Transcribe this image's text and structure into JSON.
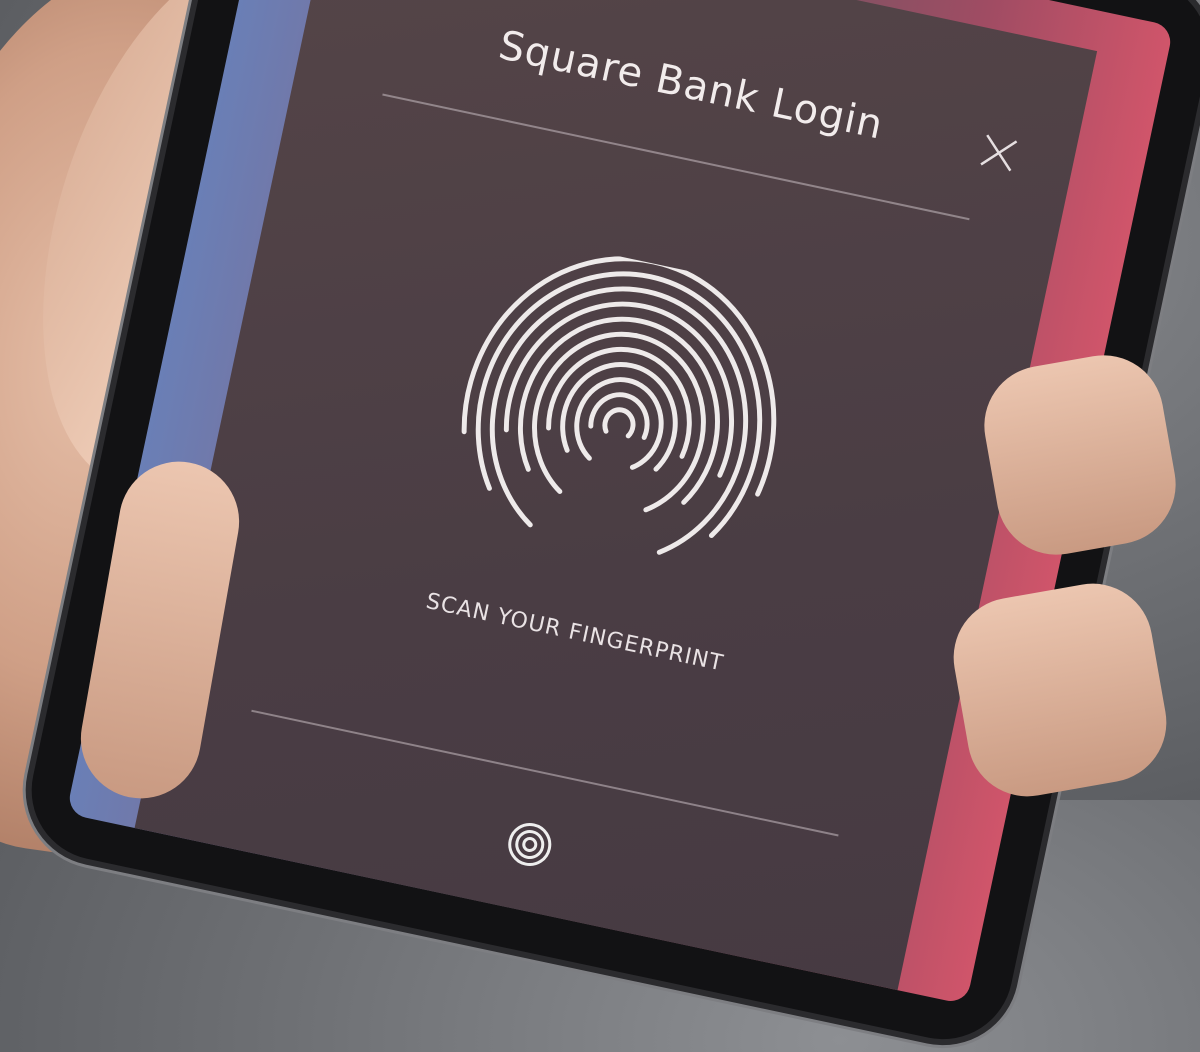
{
  "app": {
    "title": "Square Bank Login"
  },
  "login": {
    "instruction": "SCAN YOUR FINGERPRINT"
  },
  "icons": {
    "close": "close-icon",
    "fingerprint": "fingerprint-icon",
    "mini_fingerprint": "fingerprint-icon"
  },
  "colors": {
    "card": "#4f4146",
    "accent_left": "#6a7fb6",
    "accent_right": "#d0556a",
    "text": "#f2ecec"
  }
}
